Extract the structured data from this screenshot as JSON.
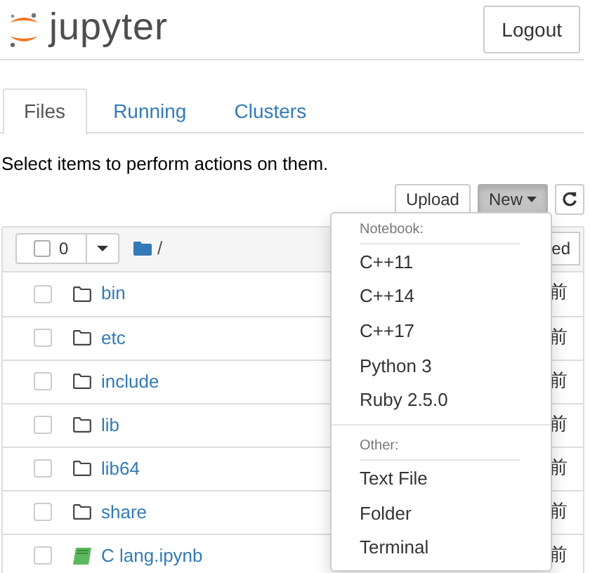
{
  "header": {
    "logo_text": "jupyter",
    "logout": "Logout"
  },
  "tabs": [
    {
      "label": "Files",
      "selected": true
    },
    {
      "label": "Running",
      "selected": false
    },
    {
      "label": "Clusters",
      "selected": false
    }
  ],
  "hint": "Select items to perform actions on them.",
  "toolbar": [
    {
      "kind": "text",
      "label": "Upload",
      "pressed": false
    },
    {
      "kind": "dropdown",
      "label": "New",
      "pressed": true
    },
    {
      "kind": "refresh",
      "pressed": false
    }
  ],
  "list_header": {
    "checked": false,
    "selected_count": "0",
    "path": "/",
    "sort_button": "ed"
  },
  "rows": [
    {
      "kind": "folder",
      "name": "bin",
      "modified": "前",
      "checked": false
    },
    {
      "kind": "folder",
      "name": "etc",
      "modified": "前",
      "checked": false
    },
    {
      "kind": "folder",
      "name": "include",
      "modified": "前",
      "checked": false
    },
    {
      "kind": "folder",
      "name": "lib",
      "modified": "前",
      "checked": false
    },
    {
      "kind": "folder",
      "name": "lib64",
      "modified": "前",
      "checked": false
    },
    {
      "kind": "folder",
      "name": "share",
      "modified": "前",
      "checked": false
    },
    {
      "kind": "notebook",
      "name": "C lang.ipynb",
      "modified": "前",
      "checked": false
    }
  ],
  "new_menu": [
    {
      "heading": "Notebook:",
      "items": [
        "C++11",
        "C++14",
        "C++17",
        "Python 3",
        "Ruby 2.5.0"
      ]
    },
    {
      "heading": "Other:",
      "items": [
        "Text File",
        "Folder",
        "Terminal"
      ]
    }
  ]
}
